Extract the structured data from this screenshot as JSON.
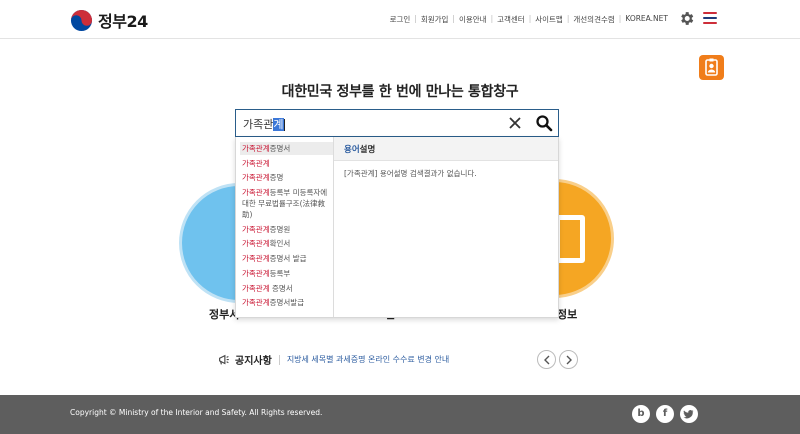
{
  "header": {
    "logo_text": "정부24",
    "nav": [
      "로그인",
      "회원가입",
      "이용안내",
      "고객센터",
      "사이트맵",
      "개선의견수렴",
      "KOREA.NET"
    ],
    "colors": {
      "red": "#cd2e3a",
      "blue": "#0047a0",
      "menu_top": "#cd2e3a",
      "menu_mid": "#1f3b7a",
      "menu_bot": "#cd2e3a"
    }
  },
  "headline": "대한민국 정부를 한 번에 만나는 통합창구",
  "search": {
    "typed": "가족관",
    "selected": "계"
  },
  "suggestions": [
    {
      "hl": "가족관계",
      "rest": "증명서"
    },
    {
      "hl": "가족관계",
      "rest": ""
    },
    {
      "hl": "가족관계",
      "rest": "증명"
    },
    {
      "hl": "가족관계",
      "rest": "등록부 미등록자에 대한 무료법률구조(法律救助)"
    },
    {
      "hl": "가족관계",
      "rest": "증명원"
    },
    {
      "hl": "가족관계",
      "rest": "확인서"
    },
    {
      "hl": "가족관계",
      "rest": "증명서 발급"
    },
    {
      "hl": "가족관계",
      "rest": "등록부"
    },
    {
      "hl": "가족관계",
      "rest": " 증명서"
    },
    {
      "hl": "가족관계",
      "rest": "증명서발급"
    }
  ],
  "term_panel": {
    "head_blue": "용어",
    "head_rest": "설명",
    "message": "[가족관계] 용어설명 검색결과가 없습니다."
  },
  "circles": {
    "left_label": "정부서",
    "mid_label": "민",
    "right_label": "정보"
  },
  "notice": {
    "title": "공지사항",
    "text": "지방세 세목별 과세증명 온라인 수수료 변경 안내"
  },
  "footer": {
    "copyright": "Copyright © Ministry of the Interior and Safety. All Rights reserved.",
    "social": [
      "b",
      "f",
      "t"
    ]
  }
}
